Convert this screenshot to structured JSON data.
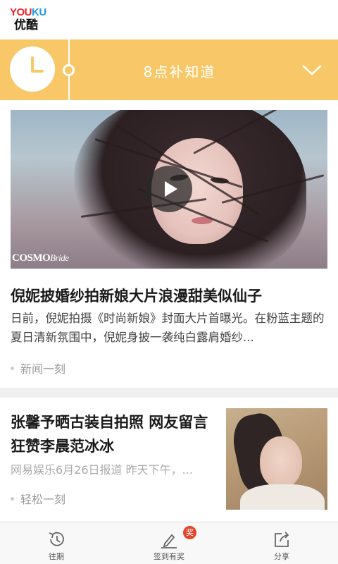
{
  "app": {
    "logo_en_you": "YOU",
    "logo_en_ku": "KU",
    "logo_cn": "优酷",
    "brand_colors": {
      "you": "#e8232a",
      "ku": "#1e9be6"
    }
  },
  "banner": {
    "title": "8点补知道",
    "background_color": "#f8c868",
    "icons": [
      "clock-icon",
      "chevron-down-icon"
    ]
  },
  "articles": [
    {
      "title": "倪妮披婚纱拍新娘大片浪漫甜美似仙子",
      "description": "日前，倪妮拍摄《时尚新娘》封面大片首曝光。在粉蓝主题的夏日清新氛围中，倪妮身披一袭纯白露肩婚纱...",
      "source": "新闻一刻",
      "image_watermark": "COSMO",
      "image_watermark_sub": "Bride",
      "has_video": true
    },
    {
      "title": "张馨予晒古装自拍照 网友留言狂赞李晨范冰冰",
      "description": "网易娱乐6月26日报道 昨天下午，...",
      "source": "轻松一刻"
    }
  ],
  "tabbar": {
    "items": [
      {
        "label": "往期",
        "icon": "history-clock-icon"
      },
      {
        "label": "签到有奖",
        "icon": "pencil-sign-icon",
        "badge": "奖"
      },
      {
        "label": "分享",
        "icon": "share-icon"
      }
    ]
  }
}
